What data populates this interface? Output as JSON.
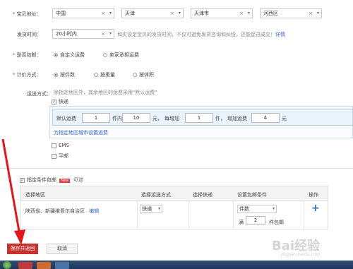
{
  "location": {
    "label": "宝贝地址：",
    "country": "中国",
    "province": "天津",
    "city": "天津市",
    "district": "河西区"
  },
  "ship_time": {
    "label": "发货时间：",
    "value": "20小时内",
    "hint": "如实设定宝贝的发货时间，不仅可避免发货咨询和纠纷，还能促进成交！",
    "hint_link": "详情"
  },
  "free_shipping": {
    "label": "是否包邮：",
    "options": [
      "自定义运费",
      "卖家承担运费"
    ]
  },
  "pricing": {
    "label": "计价方式：",
    "options": [
      "按件数",
      "按重量",
      "按体积"
    ]
  },
  "shipping_method": {
    "label": "运送方式：",
    "hint": "除指定地区外，其余地区的运费采用\"默认运费\"",
    "express_label": "快递",
    "default_fee": {
      "t1": "默认运费",
      "v1": "1",
      "t2": "件内",
      "v2": "10",
      "t3": "元，",
      "t4": "每增加",
      "v3": "1",
      "t5": "件，",
      "t6": "增加运费",
      "v4": "4",
      "t7": "元"
    },
    "region_link": "为指定地区城市设置运费",
    "ems_label": "EMS",
    "mail_label": "平邮"
  },
  "conditional": {
    "label": "指定条件包邮",
    "new_badge": "New",
    "optional": "可选",
    "headers": [
      "选择地区",
      "选择运送方式",
      "选择快递",
      "设置包邮条件",
      "操作"
    ],
    "row": {
      "region": "陕西省、新疆维吾尔自治区",
      "edit": "编辑",
      "method": "快递",
      "condition": "件数",
      "prefix": "满",
      "qty": "2",
      "suffix": "件包邮",
      "add": "+"
    }
  },
  "buttons": {
    "save": "保存并返回",
    "cancel": "取消"
  },
  "watermark": "Bai经验",
  "watermark_sub": "jingyan.baidu.com"
}
